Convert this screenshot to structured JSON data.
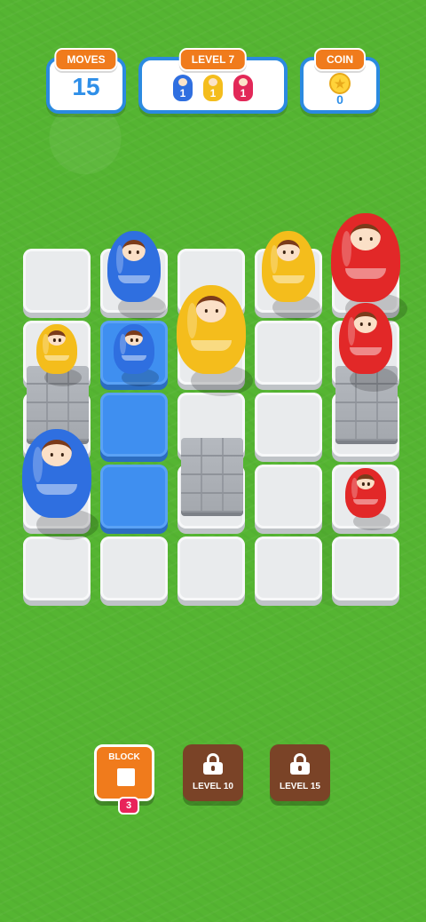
{
  "hud": {
    "moves": {
      "label": "MOVES",
      "value": "15"
    },
    "level": {
      "label": "LEVEL   7",
      "goals": [
        {
          "color": "blue",
          "count": "1"
        },
        {
          "color": "yellow",
          "count": "1"
        },
        {
          "color": "red",
          "count": "1"
        }
      ]
    },
    "coin": {
      "label": "COIN",
      "icon": "star-coin-icon",
      "value": "0"
    }
  },
  "colors": {
    "blue": "#2f6fe0",
    "yellow": "#f4bd1c",
    "red": "#e22828",
    "tile": "#e9ebed",
    "tile_blue": "#3f8ff0",
    "accent": "#f07b1c"
  },
  "board": {
    "cols": 5,
    "rows": 5,
    "blue_tiles": [
      [
        1,
        1
      ],
      [
        1,
        2
      ],
      [
        1,
        3
      ]
    ],
    "walls": [
      [
        0,
        2
      ],
      [
        2,
        3
      ],
      [
        4,
        2
      ]
    ],
    "dolls": [
      {
        "color": "blue",
        "size": "medium",
        "col": 1,
        "row": 0
      },
      {
        "color": "yellow",
        "size": "medium",
        "col": 3,
        "row": 0
      },
      {
        "color": "red",
        "size": "large",
        "col": 4,
        "row": 0
      },
      {
        "color": "yellow",
        "size": "small",
        "col": 0,
        "row": 1
      },
      {
        "color": "blue",
        "size": "small",
        "col": 1,
        "row": 1
      },
      {
        "color": "yellow",
        "size": "large",
        "col": 2,
        "row": 1
      },
      {
        "color": "red",
        "size": "medium",
        "col": 4,
        "row": 1
      },
      {
        "color": "red",
        "size": "small",
        "col": 4,
        "row": 3
      },
      {
        "color": "blue",
        "size": "large",
        "col": 0,
        "row": 3
      }
    ]
  },
  "tools": {
    "block": {
      "label": "BLOCK",
      "count": "3"
    },
    "locked1": {
      "label": "LEVEL 10",
      "icon": "lock-icon"
    },
    "locked2": {
      "label": "LEVEL 15",
      "icon": "lock-icon"
    }
  }
}
